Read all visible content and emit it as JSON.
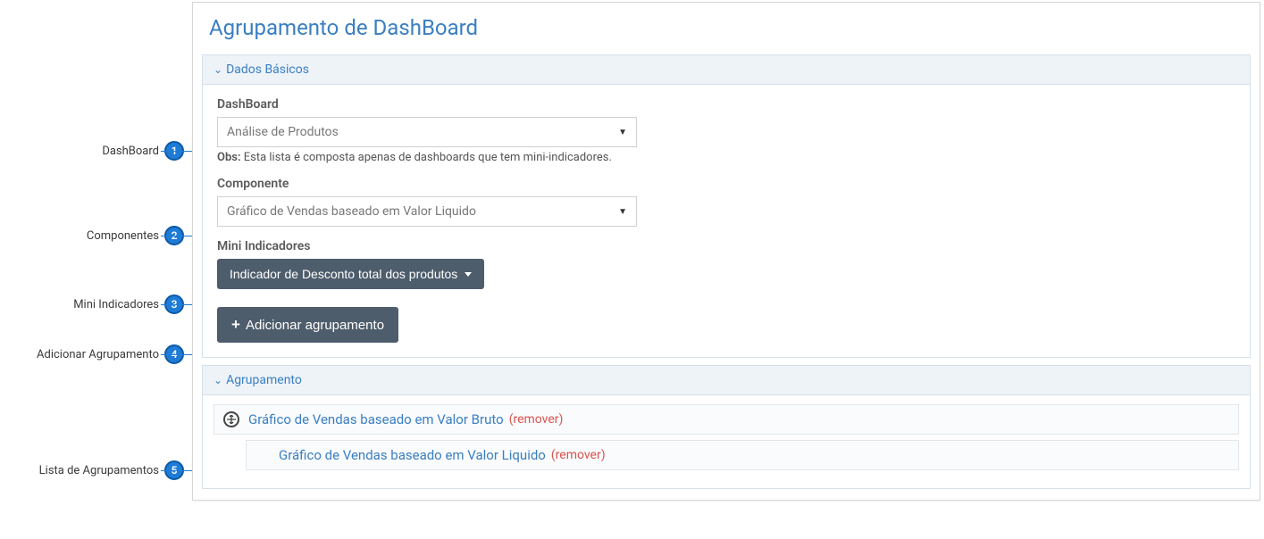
{
  "annotations": [
    {
      "label": "DashBoard",
      "num": "1"
    },
    {
      "label": "Componentes",
      "num": "2"
    },
    {
      "label": "Mini Indicadores",
      "num": "3"
    },
    {
      "label": "Adicionar Agrupamento",
      "num": "4"
    },
    {
      "label": "Lista de Agrupamentos",
      "num": "5"
    }
  ],
  "page_title": "Agrupamento de DashBoard",
  "section_basic": {
    "header": "Dados Básicos",
    "dashboard": {
      "label": "DashBoard",
      "value": "Análise de Produtos",
      "obs_prefix": "Obs:",
      "obs_text": " Esta lista é composta apenas de dashboards que tem mini-indicadores."
    },
    "componente": {
      "label": "Componente",
      "value": "Gráfico de Vendas baseado em Valor Liquido"
    },
    "mini_indicadores": {
      "label": "Mini Indicadores",
      "button_text": "Indicador de Desconto total dos produtos"
    },
    "add_button": "Adicionar agrupamento"
  },
  "section_group": {
    "header": "Agrupamento",
    "items": [
      {
        "title": "Gráfico de Vendas baseado em Valor Bruto",
        "remove": "(remover)",
        "child": false,
        "has_icon": true
      },
      {
        "title": "Gráfico de Vendas baseado em Valor Liquido",
        "remove": "(remover)",
        "child": true,
        "has_icon": false
      }
    ]
  }
}
